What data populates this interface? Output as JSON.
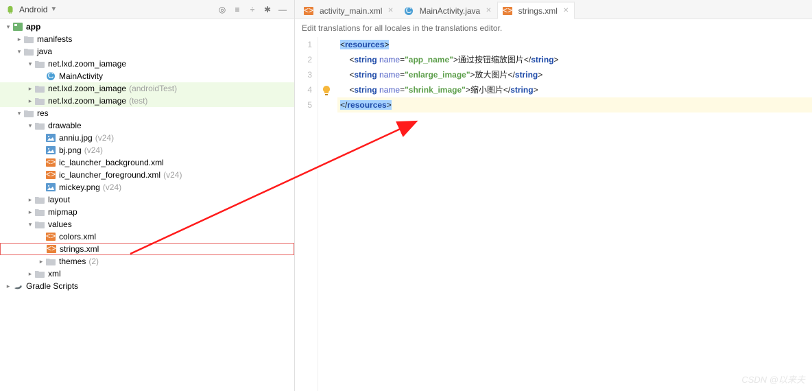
{
  "left_toolbar": {
    "title": "Android"
  },
  "tree": {
    "app": "app",
    "manifests": "manifests",
    "java": "java",
    "pkg1": "net.lxd.zoom_iamage",
    "main_activity": "MainActivity",
    "pkg2": "net.lxd.zoom_iamage",
    "pkg2_suffix": "(androidTest)",
    "pkg3": "net.lxd.zoom_iamage",
    "pkg3_suffix": "(test)",
    "res": "res",
    "drawable": "drawable",
    "anniu": "anniu.jpg",
    "anniu_suffix": "(v24)",
    "bj": "bj.png",
    "bj_suffix": "(v24)",
    "bg_xml": "ic_launcher_background.xml",
    "fg_xml": "ic_launcher_foreground.xml",
    "fg_suffix": "(v24)",
    "mickey": "mickey.png",
    "mickey_suffix": "(v24)",
    "layout": "layout",
    "mipmap": "mipmap",
    "values": "values",
    "colors": "colors.xml",
    "strings": "strings.xml",
    "themes": "themes",
    "themes_suffix": "(2)",
    "xml": "xml",
    "gradle": "Gradle Scripts"
  },
  "tabs": [
    {
      "label": "activity_main.xml",
      "type": "xml"
    },
    {
      "label": "MainActivity.java",
      "type": "java"
    },
    {
      "label": "strings.xml",
      "type": "xml",
      "active": true
    }
  ],
  "banner": "Edit translations for all locales in the translations editor.",
  "gutter": [
    "1",
    "2",
    "3",
    "4",
    "5"
  ],
  "code": {
    "l1_open": "<",
    "l1_tag": "resources",
    "l1_close": ">",
    "string_tag": "string",
    "name_attr": "name",
    "app_name_key": "\"app_name\"",
    "app_name_val": "通过按钮缩放图片",
    "enlarge_key": "\"enlarge_image\"",
    "enlarge_val": "放大图片",
    "shrink_key": "\"shrink_image\"",
    "shrink_val": "缩小图片",
    "close_string": "</",
    "lt": "<",
    "gt": ">",
    "eq": "=",
    "end_tag": "resources",
    "indent": "    "
  },
  "watermark": "CSDN @以来夫"
}
